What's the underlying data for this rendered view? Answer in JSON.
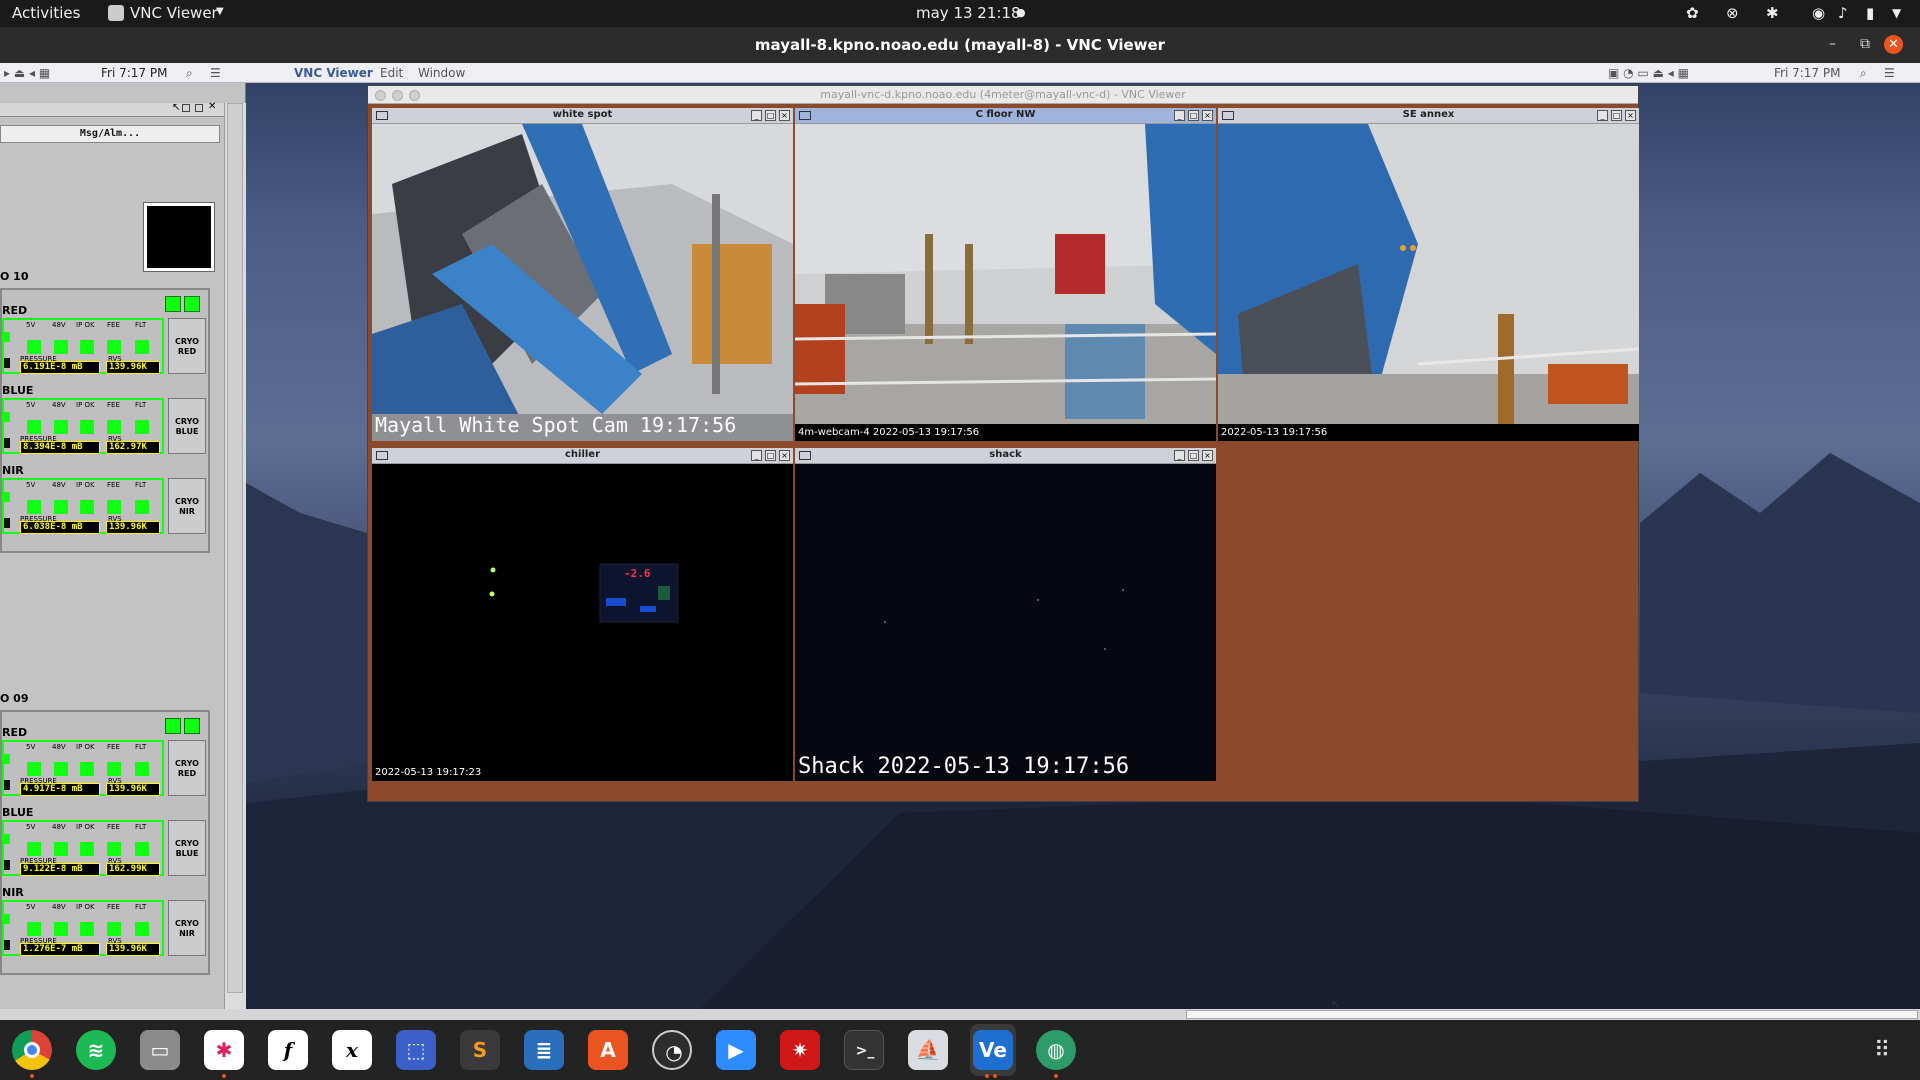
{
  "topbar": {
    "activities": "Activities",
    "app": "VNC Viewer",
    "clock": "may 13  21:18"
  },
  "titlebar": {
    "title": "mayall-8.kpno.noao.edu (mayall-8) - VNC Viewer"
  },
  "mac_menubar": {
    "left_time": "Fri 7:17 PM",
    "app": "VNC Viewer",
    "edit": "Edit",
    "window": "Window",
    "right_time": "Fri 7:17 PM"
  },
  "left_panel": {
    "button": "Msg/Alm...",
    "groups": [
      {
        "name": "O 10",
        "subs": [
          {
            "name": "RED",
            "pressure": "6.191E-8 mB",
            "rvs": "139.96K",
            "cryo": "CRYO\nRED"
          },
          {
            "name": "BLUE",
            "pressure": "8.394E-8 mB",
            "rvs": "162.97K",
            "cryo": "CRYO\nBLUE"
          },
          {
            "name": "NIR",
            "pressure": "6.038E-8 mB",
            "rvs": "139.96K",
            "cryo": "CRYO\nNIR"
          }
        ]
      },
      {
        "name": "O 09",
        "subs": [
          {
            "name": "RED",
            "pressure": "4.917E-8 mB",
            "rvs": "139.96K",
            "cryo": "CRYO\nRED"
          },
          {
            "name": "BLUE",
            "pressure": "9.122E-8 mB",
            "rvs": "162.99K",
            "cryo": "CRYO\nBLUE"
          },
          {
            "name": "NIR",
            "pressure": "1.276E-7 mB",
            "rvs": "139.96K",
            "cryo": "CRYO\nNIR"
          }
        ]
      }
    ],
    "labels": {
      "v5": "5V",
      "v48": "48V",
      "ipok": "IP OK",
      "fee": "FEE",
      "flt": "FLT",
      "pressure": "PRESSURE",
      "rvs": "RVS"
    }
  },
  "vnc_window": {
    "title": "mayall-vnc-d.kpno.noao.edu (4meter@mayall-vnc-d) - VNC Viewer",
    "cams": [
      {
        "title": "white spot",
        "caption": "Mayall White Spot Cam  19:17:56"
      },
      {
        "title": "C floor NW",
        "caption": "4m-webcam-4 2022-05-13 19:17:56"
      },
      {
        "title": "SE annex",
        "caption": "2022-05-13 19:17:56"
      },
      {
        "title": "chiller",
        "caption": "2022-05-13 19:17:23",
        "display_value": "-2.6"
      },
      {
        "title": "shack",
        "caption": "Shack 2022-05-13  19:17:56"
      }
    ]
  },
  "dock": {
    "apps": [
      "chrome-icon",
      "spotify-icon",
      "files-icon",
      "slack-icon",
      "f-icon",
      "x-icon",
      "screenshot-icon",
      "sublime-icon",
      "writer-icon",
      "software-icon",
      "obs-icon",
      "zoom-icon",
      "mathematica-icon",
      "terminal-icon",
      "preview-icon",
      "vnc-icon",
      "globe-icon"
    ],
    "vnc_label": "Ve"
  }
}
